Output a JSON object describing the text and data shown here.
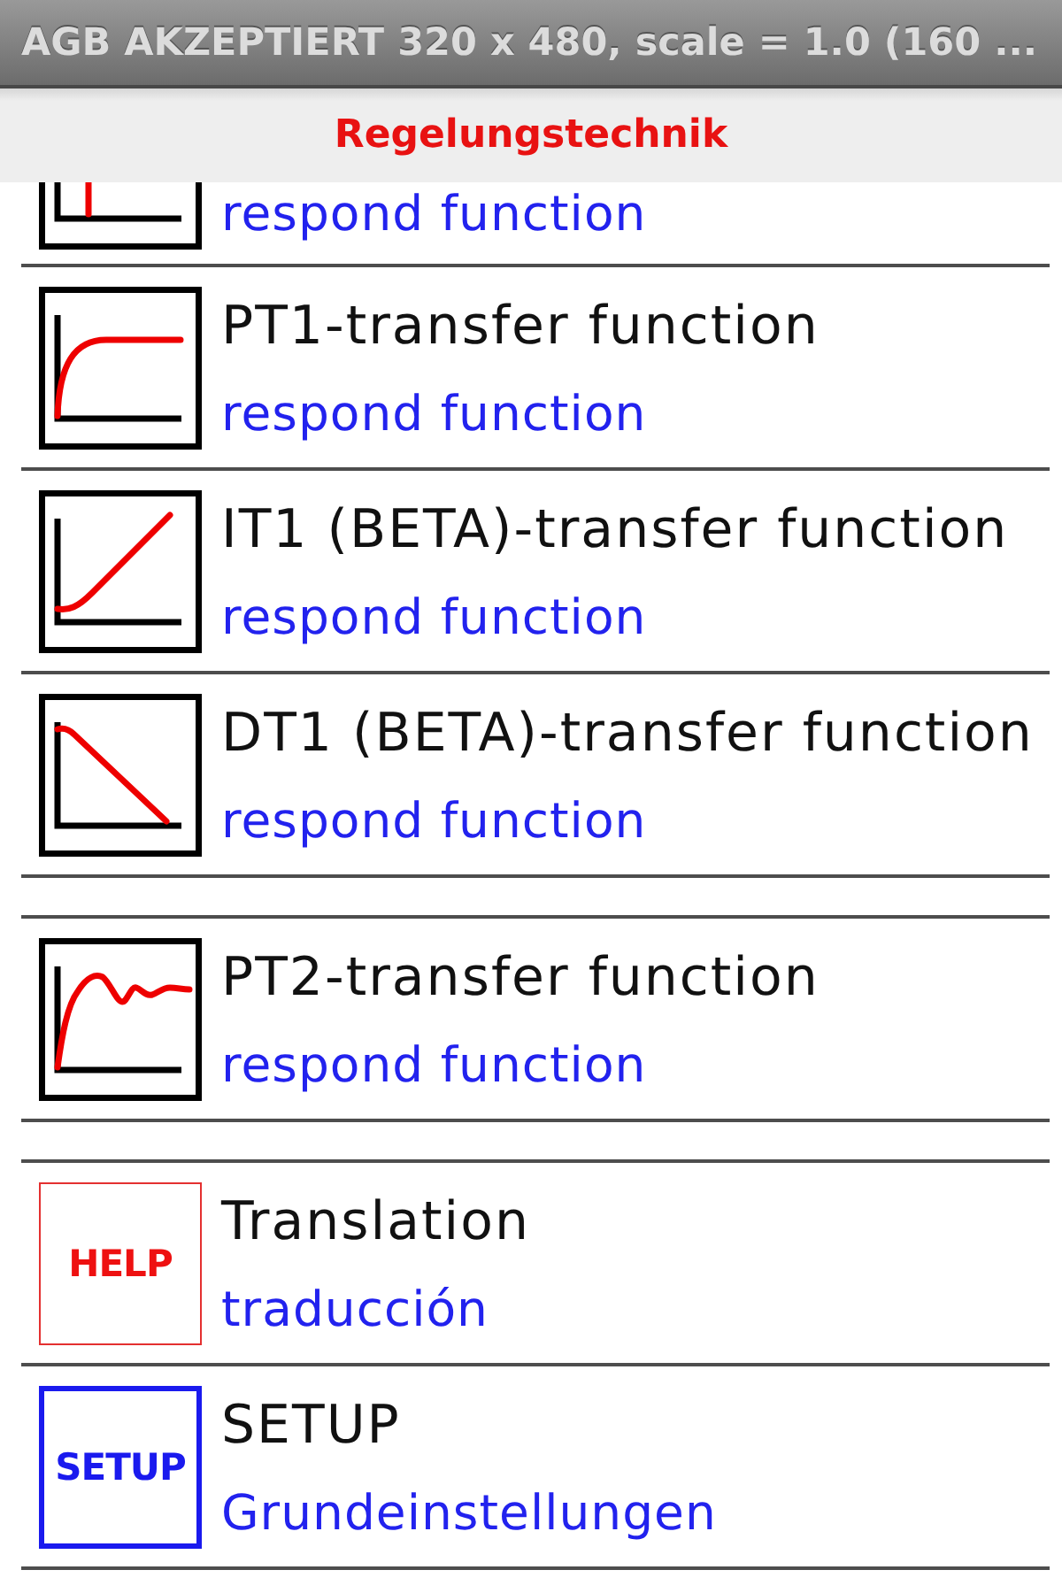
{
  "window": {
    "title": "AGB AKZEPTIERT 320 x 480, scale = 1.0 (160 ..."
  },
  "header": {
    "title": "Regelungstechnik"
  },
  "list": {
    "sections": [
      {
        "items": [
          {
            "kind": "spike",
            "clipped": true,
            "subtitle": "respond function"
          },
          {
            "kind": "pt1",
            "clipped": false,
            "title": "PT1-transfer function",
            "subtitle": "respond function"
          },
          {
            "kind": "it1",
            "clipped": false,
            "title": "IT1 (BETA)-transfer function",
            "subtitle": "respond function"
          },
          {
            "kind": "dt1",
            "clipped": false,
            "title": "DT1 (BETA)-transfer function",
            "subtitle": "respond function"
          }
        ]
      },
      {
        "items": [
          {
            "kind": "pt2",
            "clipped": false,
            "title": "PT2-transfer function",
            "subtitle": "respond function"
          }
        ]
      },
      {
        "items": [
          {
            "kind": "help",
            "clipped": false,
            "badge": "HELP",
            "title": "Translation",
            "subtitle": "traducción"
          },
          {
            "kind": "setup",
            "clipped": false,
            "badge": "SETUP",
            "title": "SETUP",
            "subtitle": "Grundeinstellungen"
          }
        ]
      }
    ]
  }
}
